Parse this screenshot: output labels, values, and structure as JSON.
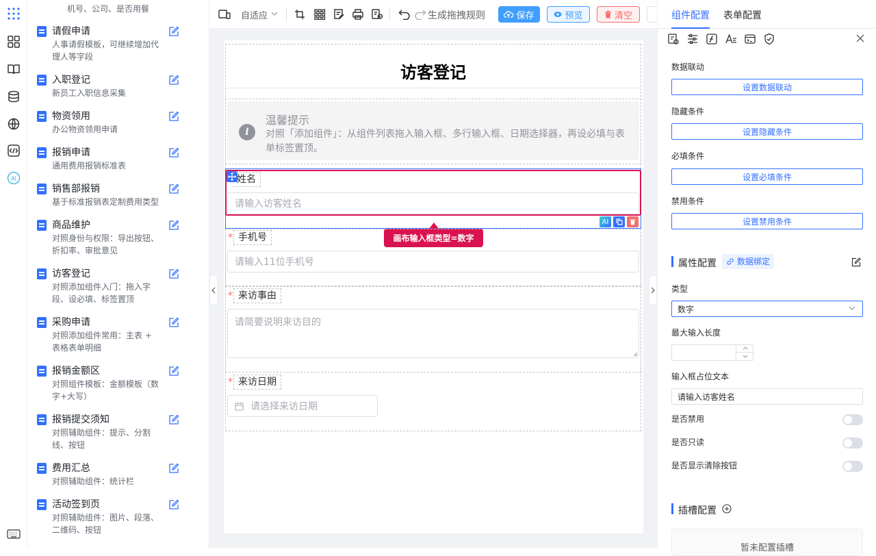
{
  "left_list": {
    "top_partial_desc": "机号、公司、是否用餐",
    "items": [
      {
        "title": "请假申请",
        "desc": "人事请假模板，可继续增加代理人等字段"
      },
      {
        "title": "入职登记",
        "desc": "新员工入职信息采集"
      },
      {
        "title": "物资领用",
        "desc": "办公物资领用申请"
      },
      {
        "title": "报销申请",
        "desc": "通用费用报销标准表"
      },
      {
        "title": "销售部报销",
        "desc": "基于标准报销表定制费用类型"
      },
      {
        "title": "商品维护",
        "desc": "对照身份与权限：导出按钮、折扣率、审批意见"
      },
      {
        "title": "访客登记",
        "desc": "对照添加组件入门：拖入字段、设必填、标签置顶"
      },
      {
        "title": "采购申请",
        "desc": "对照添加组件常用：主表 + 表格表单明细"
      },
      {
        "title": "报销金额区",
        "desc": "对照组件模板：金额模板（数字+大写）"
      },
      {
        "title": "报销提交须知",
        "desc": "对照辅助组件：提示、分割线、按钮"
      },
      {
        "title": "费用汇总",
        "desc": "对照辅助组件：统计栏"
      },
      {
        "title": "活动签到页",
        "desc": "对照辅助组件：图片、段落、二维码、按钮"
      }
    ]
  },
  "toolbar": {
    "adapt_label": "自适应",
    "gen_rules": "生成拖拽规则",
    "save": "保存",
    "preview": "预览",
    "clear": "清空"
  },
  "form": {
    "title": "访客登记",
    "tip_title": "温馨提示",
    "tip_desc": "对照「添加组件」：从组件列表拖入输入框、多行输入框、日期选择器，再设必填与表单标签置顶。",
    "fields": [
      {
        "label": "姓名",
        "placeholder": "请输入访客姓名"
      },
      {
        "label": "手机号",
        "placeholder": "请输入11位手机号",
        "required": "*"
      },
      {
        "label": "来访事由",
        "placeholder": "请简要说明来访目的",
        "required": "*"
      },
      {
        "label": "来访日期",
        "placeholder": "请选择来访日期",
        "required": "*"
      }
    ],
    "callout": "画布输入框类型=数字",
    "mini_ai": "AI"
  },
  "right": {
    "tabs": [
      "组件配置",
      "表单配置"
    ],
    "linkage_label": "数据联动",
    "linkage_btn": "设置数据联动",
    "hide_label": "隐藏条件",
    "hide_btn": "设置隐藏条件",
    "required_label": "必填条件",
    "required_btn": "设置必填条件",
    "disable_label": "禁用条件",
    "disable_btn": "设置禁用条件",
    "attr_title": "属性配置",
    "bind_label": "数据绑定",
    "type_label": "类型",
    "type_value": "数字",
    "maxlen_label": "最大输入长度",
    "placeholder_label": "输入框占位文本",
    "placeholder_value": "请输入访客姓名",
    "disabled_label": "是否禁用",
    "readonly_label": "是否只读",
    "clearable_label": "是否显示清除按钮",
    "slot_title": "插槽配置",
    "slot_empty": "暂未配置插槽"
  },
  "colors": {
    "accent": "#3370ff",
    "highlight": "#d9134f",
    "danger": "#f56c6c"
  }
}
